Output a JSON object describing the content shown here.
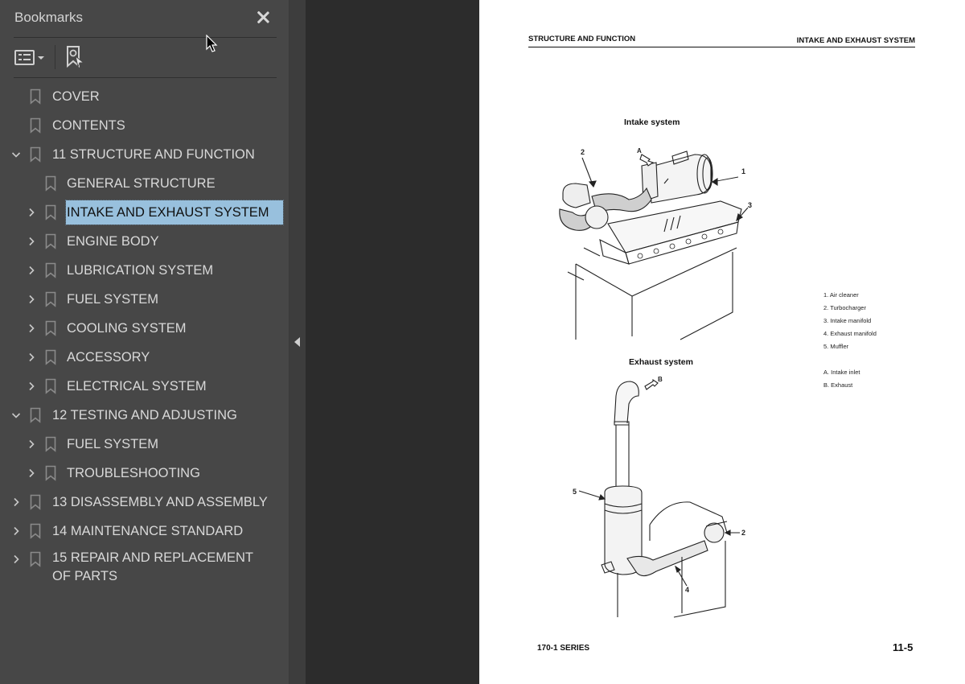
{
  "bookmarks_panel": {
    "title": "Bookmarks",
    "close_label": "Close",
    "options_label": "Options",
    "find_bookmark_label": "Find current bookmark",
    "items": [
      {
        "label": "COVER",
        "level": 0,
        "expander": "none"
      },
      {
        "label": "CONTENTS",
        "level": 0,
        "expander": "none"
      },
      {
        "label": "11 STRUCTURE AND FUNCTION",
        "level": 0,
        "expander": "expanded"
      },
      {
        "label": "GENERAL STRUCTURE",
        "level": 1,
        "expander": "none"
      },
      {
        "label": "INTAKE AND EXHAUST SYSTEM",
        "level": 1,
        "expander": "collapsed",
        "selected": true
      },
      {
        "label": "ENGINE BODY",
        "level": 1,
        "expander": "collapsed"
      },
      {
        "label": "LUBRICATION SYSTEM",
        "level": 1,
        "expander": "collapsed"
      },
      {
        "label": "FUEL SYSTEM",
        "level": 1,
        "expander": "collapsed"
      },
      {
        "label": "COOLING SYSTEM",
        "level": 1,
        "expander": "collapsed"
      },
      {
        "label": "ACCESSORY",
        "level": 1,
        "expander": "collapsed"
      },
      {
        "label": "ELECTRICAL SYSTEM",
        "level": 1,
        "expander": "collapsed"
      },
      {
        "label": "12 TESTING AND ADJUSTING",
        "level": 0,
        "expander": "expanded"
      },
      {
        "label": "FUEL SYSTEM",
        "level": 1,
        "expander": "collapsed"
      },
      {
        "label": "TROUBLESHOOTING",
        "level": 1,
        "expander": "collapsed"
      },
      {
        "label": "13 DISASSEMBLY AND ASSEMBLY",
        "level": 0,
        "expander": "collapsed"
      },
      {
        "label": "14 MAINTENANCE STANDARD",
        "level": 0,
        "expander": "collapsed"
      },
      {
        "label": "15 REPAIR AND REPLACEMENT OF PARTS",
        "level": 0,
        "expander": "collapsed"
      }
    ],
    "selection_color": "#98c0dd"
  },
  "page": {
    "header_left": "STRUCTURE AND FUNCTION",
    "header_right": "INTAKE AND EXHAUST SYSTEM",
    "intake_title": "Intake system",
    "exhaust_title": "Exhaust system",
    "intake_callouts": {
      "c1": "1",
      "c2": "2",
      "c3": "3",
      "cA": "A"
    },
    "exhaust_callouts": {
      "c2": "2",
      "c4": "4",
      "c5": "5",
      "cB": "B"
    },
    "legend": [
      "1.  Air cleaner",
      "2.  Turbocharger",
      "3.  Intake manifold",
      "4.  Exhaust manifold",
      "5.  Muffler"
    ],
    "legend_letters": [
      "A.  Intake inlet",
      "B.  Exhaust"
    ],
    "footer_left": "170-1 SERIES",
    "footer_right": "11-5"
  }
}
